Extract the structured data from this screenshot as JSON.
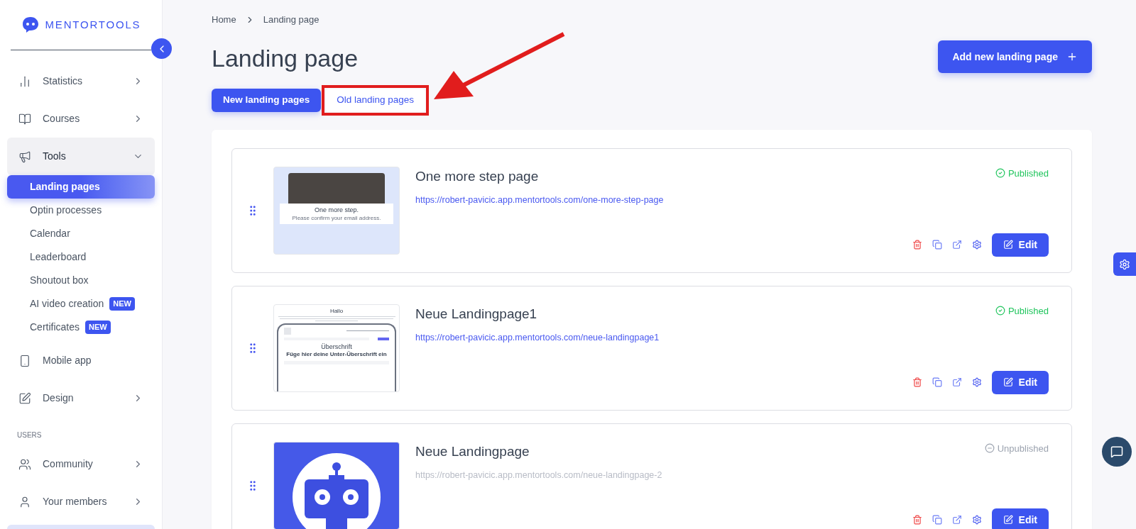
{
  "sidebar": {
    "logo": "MENTORTOOLS",
    "items": [
      {
        "kind": "group",
        "label": "Statistics",
        "expanded": false
      },
      {
        "kind": "group",
        "label": "Courses",
        "expanded": false
      },
      {
        "kind": "group",
        "label": "Tools",
        "expanded": true,
        "children": [
          {
            "label": "Landing pages",
            "selected": true
          },
          {
            "label": "Optin processes",
            "selected": false
          },
          {
            "label": "Calendar",
            "selected": false
          },
          {
            "label": "Leaderboard",
            "selected": false
          },
          {
            "label": "Shoutout box",
            "selected": false
          },
          {
            "label": "AI video creation",
            "selected": false,
            "badge": "NEW"
          },
          {
            "label": "Certificates",
            "selected": false,
            "badge": "NEW"
          }
        ]
      },
      {
        "kind": "link",
        "label": "Mobile app"
      },
      {
        "kind": "group",
        "label": "Design",
        "expanded": false
      },
      {
        "kind": "heading",
        "label": "USERS"
      },
      {
        "kind": "group",
        "label": "Community",
        "expanded": false
      },
      {
        "kind": "group",
        "label": "Your members",
        "expanded": false
      }
    ]
  },
  "breadcrumb": [
    "Home",
    "Landing page"
  ],
  "title": "Landing page",
  "add_button": "Add new landing page",
  "tabs": [
    {
      "label": "New landing pages",
      "selected": true,
      "highlighted": false
    },
    {
      "label": "Old landing pages",
      "selected": false,
      "highlighted": true
    }
  ],
  "pages": [
    {
      "title": "One more step page",
      "url": "https://robert-pavicic.app.mentortools.com/one-more-step-page",
      "status": "Published",
      "published": true,
      "edit": "Edit",
      "thumbnail": {
        "kind": "confirm",
        "heading": "One more step.",
        "subheading": "Please confirm your email address."
      }
    },
    {
      "title": "Neue Landingpage1",
      "url": "https://robert-pavicic.app.mentortools.com/neue-landingpage1",
      "status": "Published",
      "published": true,
      "edit": "Edit",
      "thumbnail": {
        "kind": "page",
        "heading": "Hallo",
        "headline": "Überschrift",
        "subheading": "Füge hier deine Unter-Überschrift ein"
      }
    },
    {
      "title": "Neue Landingpage",
      "url": "https://robert-pavicic.app.mentortools.com/neue-landingpage-2",
      "status": "Unpublished",
      "published": false,
      "edit": "Edit",
      "thumbnail": {
        "kind": "robot"
      }
    }
  ]
}
